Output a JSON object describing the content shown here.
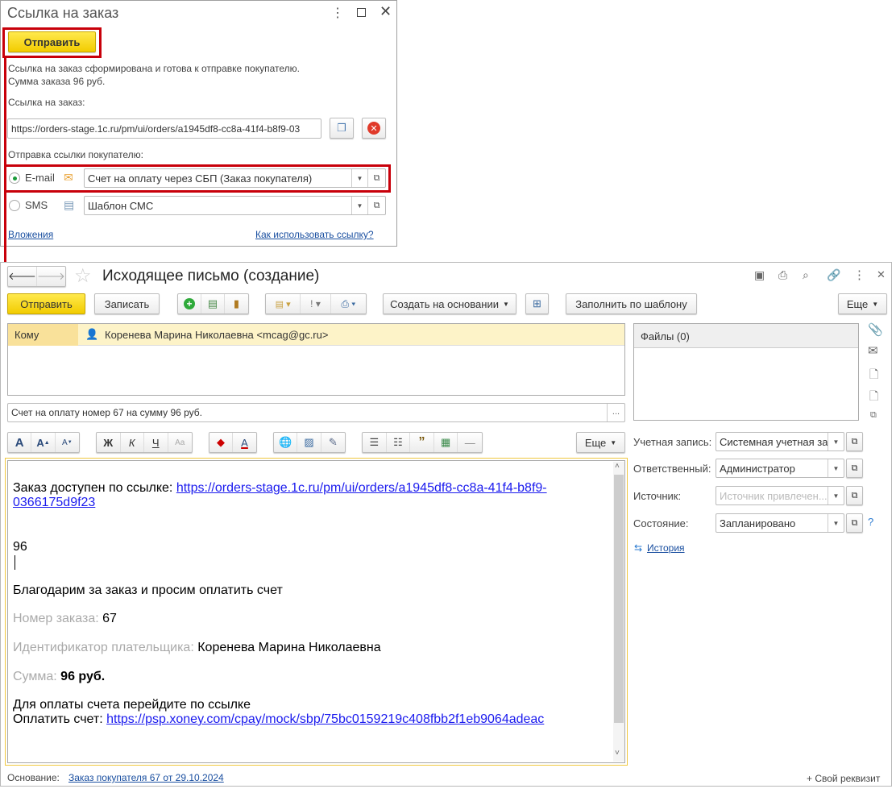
{
  "popup": {
    "title": "Ссылка на заказ",
    "send_label": "Отправить",
    "message_line1": "Ссылка на заказ сформирована и готова к отправке покупателю.",
    "message_line2": "Сумма заказа 96 руб.",
    "link_label": "Ссылка на заказ:",
    "link_value": "https://orders-stage.1c.ru/pm/ui/orders/a1945df8-cc8a-41f4-b8f9-03",
    "send_section_label": "Отправка ссылки покупателю:",
    "email_label": "E-mail",
    "email_template": "Счет на оплату через СБП (Заказ покупателя)",
    "sms_label": "SMS",
    "sms_template": "Шаблон СМС",
    "attachments_link": "Вложения",
    "howto_link": "Как использовать ссылку?",
    "selected_channel": "E-mail"
  },
  "main": {
    "title": "Исходящее письмо (создание)",
    "toolbar": {
      "send": "Отправить",
      "save": "Записать",
      "create_based": "Создать на основании",
      "fill_template": "Заполнить по шаблону",
      "more": "Еще"
    },
    "to_label": "Кому",
    "to_value": "Коренева Марина Николаевна <mcag@gc.ru>",
    "files_label": "Файлы (0)",
    "subject": "Счет на оплату номер 67 на сумму 96 руб.",
    "subject_more": "...",
    "format_toolbar": {
      "bold": "Ж",
      "italic": "К",
      "underline": "Ч",
      "more": "Еще"
    },
    "body": {
      "line1_text": "Заказ доступен по ссылке: ",
      "line1_link_a": "https://orders-stage.1c.ru/pm/ui/orders/a1945df8-cc8a-41f4-b8f9-",
      "line1_link_b": "0366175d9f23",
      "amount": "96",
      "thanks": "Благодарим за заказ и просим оплатить счет",
      "order_no_label": "Номер заказа:",
      "order_no": "67",
      "payer_label": "Идентификатор плательщика:",
      "payer": "Коренева Марина Николаевна",
      "sum_label": "Сумма:",
      "sum": "96 руб.",
      "pay_intro": "Для оплаты счета перейдите по ссылке",
      "pay_label": "Оплатить счет: ",
      "pay_link": "https://psp.xoney.com/cpay/mock/sbp/75bc0159219c408fbb2f1eb9064adeac"
    },
    "fields": {
      "account_label": "Учетная запись:",
      "account": "Системная учетная за",
      "responsible_label": "Ответственный:",
      "responsible": "Администратор",
      "source_label": "Источник:",
      "source_placeholder": "Источник привлечен...",
      "state_label": "Состояние:",
      "state": "Запланировано",
      "help": "?",
      "history": "История"
    },
    "footer": {
      "basis_label": "Основание:",
      "basis_link": "Заказ покупателя 67 от 29.10.2024",
      "custom_attr": "+ Свой реквизит"
    }
  },
  "colors": {
    "accent_yellow": "#f5d000",
    "highlight_red": "#c8000a",
    "to_row_bg": "#fdf3c8",
    "link": "#1a4fa0"
  }
}
